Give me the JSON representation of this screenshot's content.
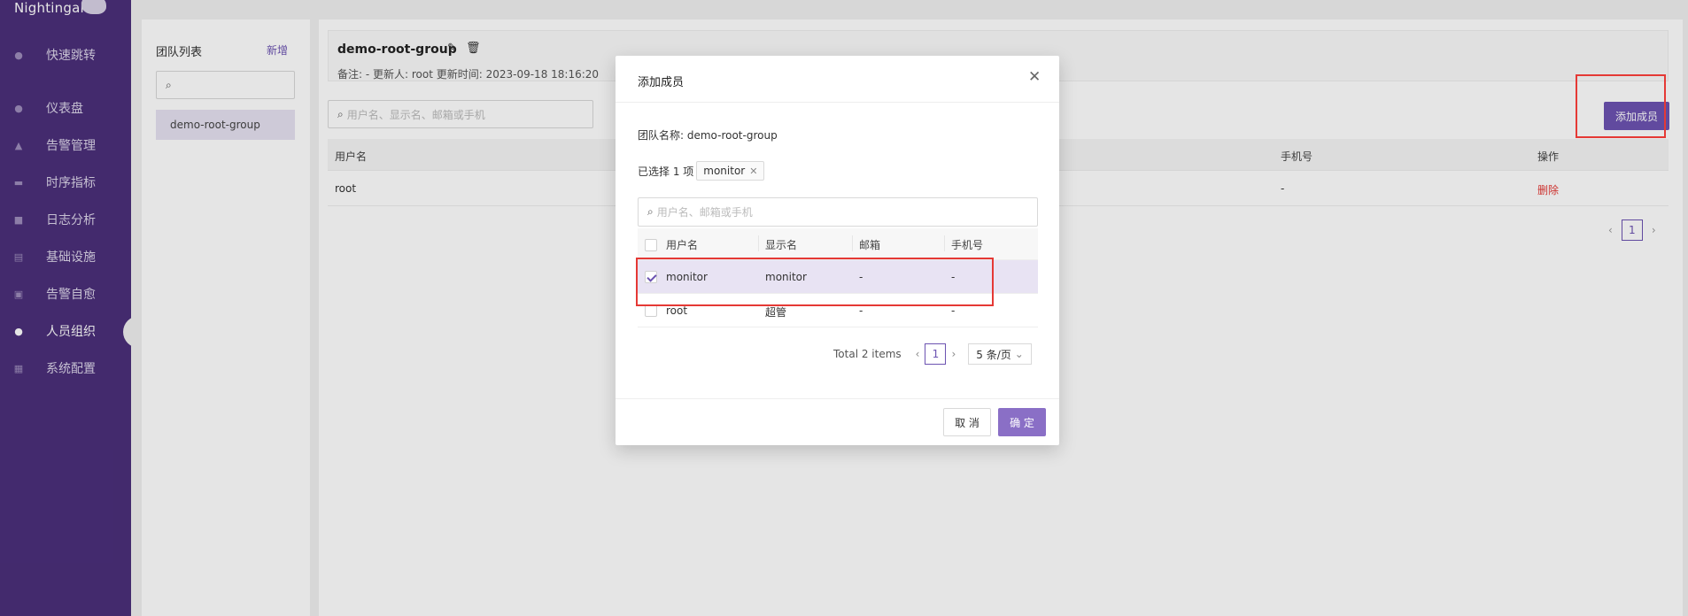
{
  "app": {
    "logo": "Nightingale"
  },
  "sidebar": {
    "items": [
      {
        "label": "快速跳转",
        "icon": "search-icon"
      },
      {
        "label": "仪表盘",
        "icon": "dashboard-icon"
      },
      {
        "label": "告警管理",
        "icon": "alarm-icon"
      },
      {
        "label": "时序指标",
        "icon": "chart-icon"
      },
      {
        "label": "日志分析",
        "icon": "log-icon"
      },
      {
        "label": "基础设施",
        "icon": "server-icon"
      },
      {
        "label": "告警自愈",
        "icon": "terminal-icon"
      },
      {
        "label": "人员组织",
        "icon": "user-icon"
      },
      {
        "label": "系统配置",
        "icon": "grid-icon"
      }
    ]
  },
  "team_panel": {
    "title": "团队列表",
    "add_label": "新增",
    "search_value": "",
    "selected_team": "demo-root-group"
  },
  "group": {
    "name": "demo-root-group",
    "meta": "备注:  -   更新人:  root   更新时间:  2023-09-18 18:16:20",
    "search_placeholder": "用户名、显示名、邮箱或手机",
    "add_member_label": "添加成员",
    "columns": [
      "用户名",
      "手机号",
      "操作"
    ],
    "rows": [
      {
        "username": "root",
        "phone": "-",
        "action": "删除"
      }
    ],
    "page": "1"
  },
  "modal": {
    "title": "添加成员",
    "team_name_line": "团队名称:  demo-root-group",
    "selected_prefix": "已选择 1 项",
    "selected_tag": "monitor",
    "search_placeholder": "用户名、邮箱或手机",
    "columns": [
      "用户名",
      "显示名",
      "邮箱",
      "手机号"
    ],
    "rows": [
      {
        "username": "monitor",
        "display": "monitor",
        "email": "-",
        "phone": "-",
        "checked": true
      },
      {
        "username": "root",
        "display": "超管",
        "email": "-",
        "phone": "-",
        "checked": false
      }
    ],
    "total": "Total 2 items",
    "page": "1",
    "page_size": "5 条/页",
    "cancel_label": "取 消",
    "ok_label": "确 定"
  },
  "colors": {
    "brand": "#4b2f7a",
    "accent": "#6c53b1",
    "danger": "#e53935"
  }
}
